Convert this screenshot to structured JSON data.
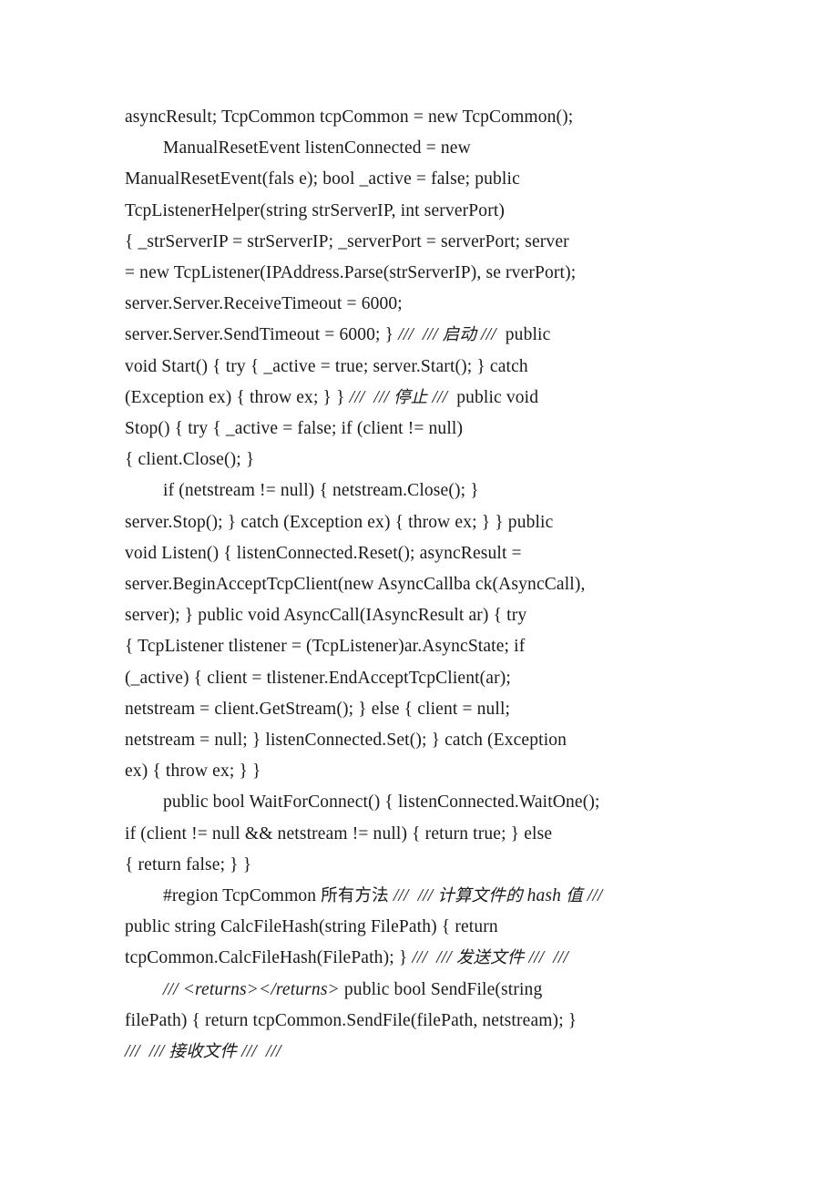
{
  "document": {
    "kind": "text-document-page",
    "page_background": "#ffffff",
    "text_color": "#1a1a1a",
    "lines": [
      {
        "id": "line-1",
        "indent": false,
        "runs": [
          {
            "style": "code",
            "text": "asyncResult; TcpCommon tcpCommon = new TcpCommon();"
          }
        ]
      },
      {
        "id": "line-2",
        "indent": true,
        "runs": [
          {
            "style": "code",
            "text": "ManualResetEvent listenConnected = new"
          }
        ]
      },
      {
        "id": "line-3",
        "indent": false,
        "runs": [
          {
            "style": "code",
            "text": "ManualResetEvent(fals e); bool _active = false; public"
          }
        ]
      },
      {
        "id": "line-4",
        "indent": false,
        "runs": [
          {
            "style": "code",
            "text": "TcpListenerHelper(string strServerIP, int serverPort)"
          }
        ]
      },
      {
        "id": "line-5",
        "indent": false,
        "runs": [
          {
            "style": "code",
            "text": "{ _strServerIP = strServerIP; _serverPort = serverPort; server"
          }
        ]
      },
      {
        "id": "line-6",
        "indent": false,
        "runs": [
          {
            "style": "code",
            "text": "= new TcpListener(IPAddress.Parse(strServerIP), se rverPort);"
          }
        ]
      },
      {
        "id": "line-7",
        "indent": false,
        "runs": [
          {
            "style": "code",
            "text": "server.Server.ReceiveTimeout = 6000;"
          }
        ]
      },
      {
        "id": "line-8",
        "indent": false,
        "runs": [
          {
            "style": "code",
            "text": "server.Server.SendTimeout = 6000; } "
          },
          {
            "style": "comment",
            "text": "///  /// "
          },
          {
            "style": "comment-cjk",
            "text": "启动"
          },
          {
            "style": "comment",
            "text": " /// "
          },
          {
            "style": "code",
            "text": " public"
          }
        ]
      },
      {
        "id": "line-9",
        "indent": false,
        "runs": [
          {
            "style": "code",
            "text": "void Start() { try { _active = true; server.Start(); } catch"
          }
        ]
      },
      {
        "id": "line-10",
        "indent": false,
        "runs": [
          {
            "style": "code",
            "text": "(Exception ex) { throw ex; } } "
          },
          {
            "style": "comment",
            "text": "///  /// "
          },
          {
            "style": "comment-cjk",
            "text": "停止"
          },
          {
            "style": "comment",
            "text": " /// "
          },
          {
            "style": "code",
            "text": " public void"
          }
        ]
      },
      {
        "id": "line-11",
        "indent": false,
        "runs": [
          {
            "style": "code",
            "text": "Stop() { try { _active = false; if (client != null)"
          }
        ]
      },
      {
        "id": "line-12",
        "indent": false,
        "runs": [
          {
            "style": "code",
            "text": "{ client.Close(); }"
          }
        ]
      },
      {
        "id": "line-13",
        "indent": true,
        "runs": [
          {
            "style": "code",
            "text": "if (netstream != null) { netstream.Close(); }"
          }
        ]
      },
      {
        "id": "line-14",
        "indent": false,
        "runs": [
          {
            "style": "code",
            "text": "server.Stop(); } catch (Exception ex) { throw ex; } } public"
          }
        ]
      },
      {
        "id": "line-15",
        "indent": false,
        "runs": [
          {
            "style": "code",
            "text": "void Listen() { listenConnected.Reset(); asyncResult ="
          }
        ]
      },
      {
        "id": "line-16",
        "indent": false,
        "runs": [
          {
            "style": "code",
            "text": "server.BeginAcceptTcpClient(new AsyncCallba ck(AsyncCall),"
          }
        ]
      },
      {
        "id": "line-17",
        "indent": false,
        "runs": [
          {
            "style": "code",
            "text": "server); } public void AsyncCall(IAsyncResult ar) { try"
          }
        ]
      },
      {
        "id": "line-18",
        "indent": false,
        "runs": [
          {
            "style": "code",
            "text": "{ TcpListener tlistener = (TcpListener)ar.AsyncState; if"
          }
        ]
      },
      {
        "id": "line-19",
        "indent": false,
        "runs": [
          {
            "style": "code",
            "text": "(_active) { client = tlistener.EndAcceptTcpClient(ar);"
          }
        ]
      },
      {
        "id": "line-20",
        "indent": false,
        "runs": [
          {
            "style": "code",
            "text": "netstream = client.GetStream(); } else { client = null;"
          }
        ]
      },
      {
        "id": "line-21",
        "indent": false,
        "runs": [
          {
            "style": "code",
            "text": "netstream = null; } listenConnected.Set(); } catch (Exception"
          }
        ]
      },
      {
        "id": "line-22",
        "indent": false,
        "runs": [
          {
            "style": "code",
            "text": "ex) { throw ex; } }"
          }
        ]
      },
      {
        "id": "line-23",
        "indent": true,
        "runs": [
          {
            "style": "code",
            "text": "public bool WaitForConnect() { listenConnected.WaitOne();"
          }
        ]
      },
      {
        "id": "line-24",
        "indent": false,
        "runs": [
          {
            "style": "code",
            "text": "if (client != null && netstream != null) { return true; } else"
          }
        ]
      },
      {
        "id": "line-25",
        "indent": false,
        "runs": [
          {
            "style": "code",
            "text": "{ return false; } }"
          }
        ]
      },
      {
        "id": "line-26",
        "indent": true,
        "runs": [
          {
            "style": "code",
            "text": "#region TcpCommon "
          },
          {
            "style": "code-cjk",
            "text": "所有方法"
          },
          {
            "style": "comment",
            "text": " ///  /// "
          },
          {
            "style": "comment-cjk",
            "text": "计算文件的"
          },
          {
            "style": "comment",
            "text": " hash "
          },
          {
            "style": "comment-cjk",
            "text": "值"
          },
          {
            "style": "comment",
            "text": " ///"
          }
        ]
      },
      {
        "id": "line-27",
        "indent": false,
        "runs": [
          {
            "style": "code",
            "text": "public string CalcFileHash(string FilePath) { return"
          }
        ]
      },
      {
        "id": "line-28",
        "indent": false,
        "runs": [
          {
            "style": "code",
            "text": "tcpCommon.CalcFileHash(FilePath); } "
          },
          {
            "style": "comment",
            "text": "///  /// "
          },
          {
            "style": "comment-cjk",
            "text": "发送文件"
          },
          {
            "style": "comment",
            "text": " ///  ///"
          }
        ]
      },
      {
        "id": "line-29",
        "indent": true,
        "runs": [
          {
            "style": "comment",
            "text": "/// <returns></returns> "
          },
          {
            "style": "code",
            "text": "public bool SendFile(string"
          }
        ]
      },
      {
        "id": "line-30",
        "indent": false,
        "runs": [
          {
            "style": "code",
            "text": "filePath) { return tcpCommon.SendFile(filePath, netstream); }"
          }
        ]
      },
      {
        "id": "line-31",
        "indent": false,
        "runs": [
          {
            "style": "comment",
            "text": "///  /// "
          },
          {
            "style": "comment-cjk",
            "text": "接收文件"
          },
          {
            "style": "comment",
            "text": " ///  ///"
          }
        ]
      }
    ]
  }
}
